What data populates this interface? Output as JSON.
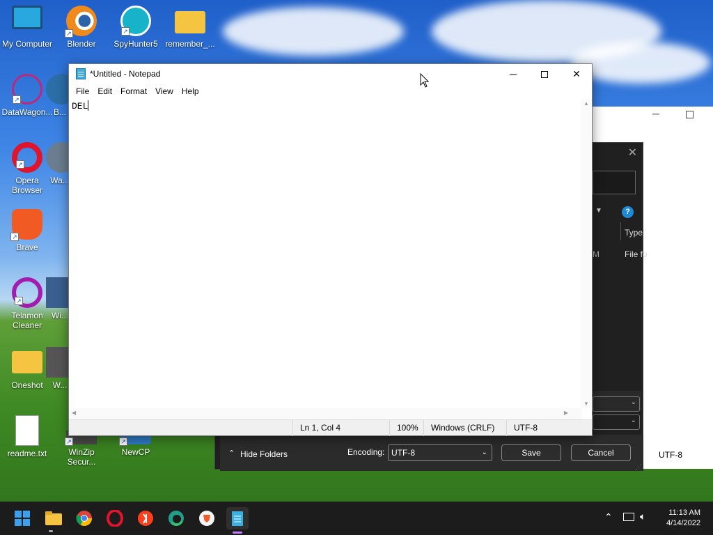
{
  "desktop": {
    "icons": [
      {
        "label": "My Computer"
      },
      {
        "label": "Blender"
      },
      {
        "label": "SpyHunter5"
      },
      {
        "label": "remember_..."
      },
      {
        "label": "DataWagon..."
      },
      {
        "label": "B..."
      },
      {
        "label": "Opera Browser"
      },
      {
        "label": "Wa..."
      },
      {
        "label": "Brave"
      },
      {
        "label": "Telamon Cleaner"
      },
      {
        "label": "Wi..."
      },
      {
        "label": "Oneshot"
      },
      {
        "label": "W..."
      },
      {
        "label": "readme.txt"
      },
      {
        "label": "WinZip Secur..."
      },
      {
        "label": "NewCP"
      }
    ]
  },
  "save_dialog": {
    "type_header": "Type",
    "type_value": "File fo",
    "m_fragment": "M",
    "hide_folders": "Hide Folders",
    "encoding_label": "Encoding:",
    "encoding_value": "UTF-8",
    "save_label": "Save",
    "cancel_label": "Cancel",
    "right_encoding": "UTF-8"
  },
  "notepad": {
    "title": "*Untitled - Notepad",
    "menu": [
      "File",
      "Edit",
      "Format",
      "View",
      "Help"
    ],
    "content": "DEL",
    "status": {
      "position": "Ln 1, Col 4",
      "zoom": "100%",
      "line_ending": "Windows (CRLF)",
      "encoding": "UTF-8"
    }
  },
  "taskbar": {
    "time": "11:13 AM",
    "date": "4/14/2022",
    "apps": [
      "start-icon",
      "file-explorer-icon",
      "chrome-icon",
      "opera-icon",
      "yandex-icon",
      "edge-icon",
      "brave-icon",
      "notepad-icon"
    ]
  },
  "colors": {
    "accent": "#0067c0",
    "taskbar": "#1c1c1c",
    "dialog_dark": "#202020"
  }
}
